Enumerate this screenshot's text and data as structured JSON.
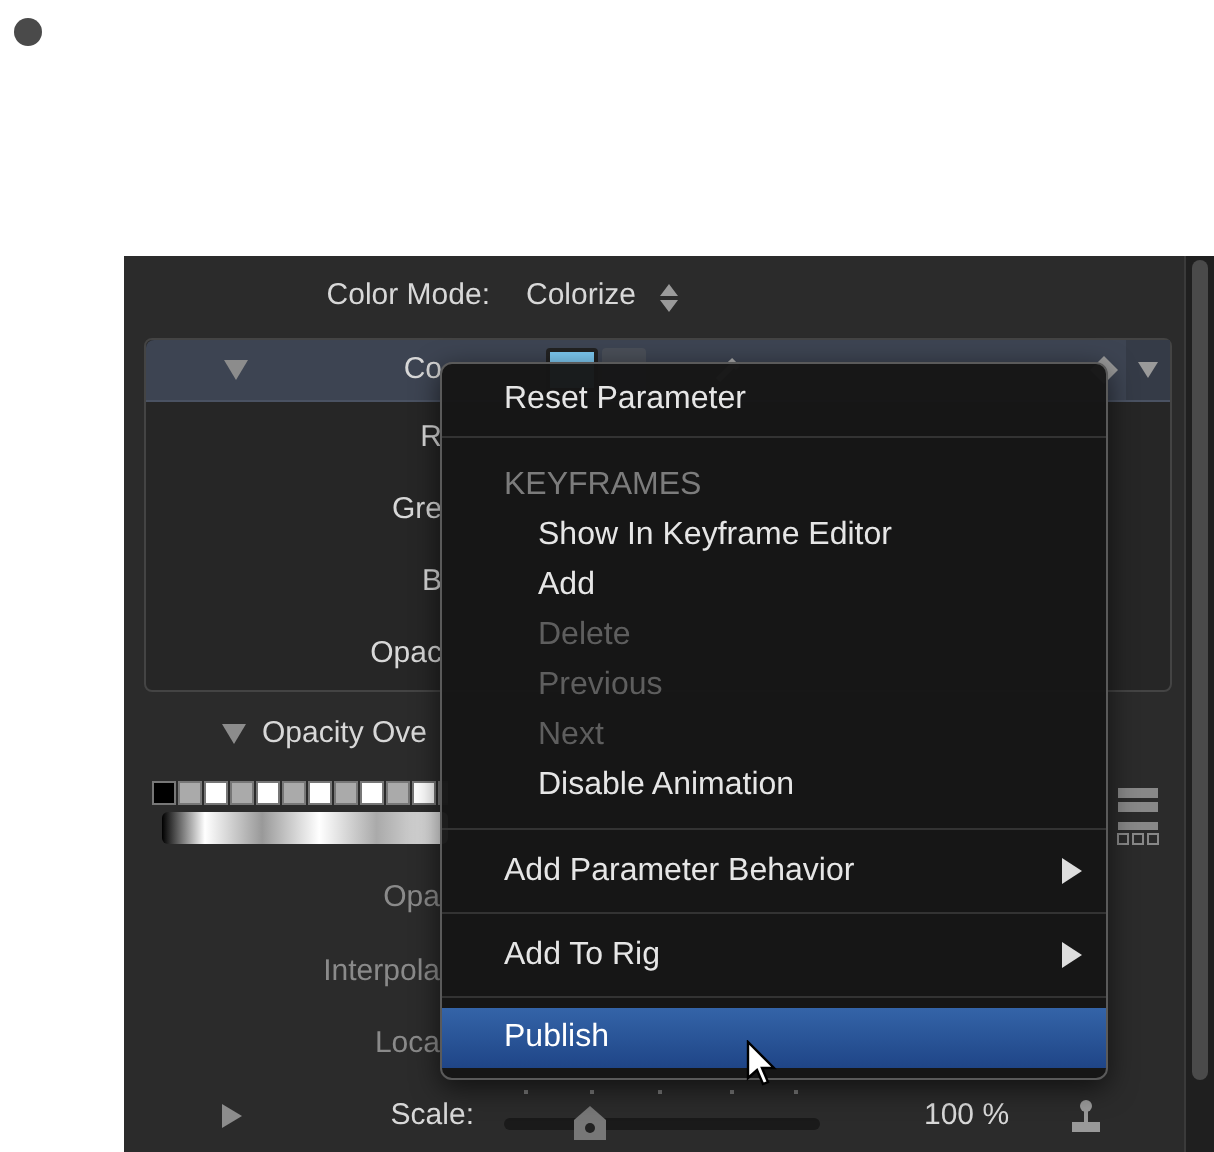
{
  "inspector": {
    "color_mode": {
      "label": "Color Mode:",
      "value": "Colorize"
    },
    "color_group": {
      "label": "Co",
      "expanded": true,
      "rows": [
        {
          "label": "R"
        },
        {
          "label": "Gre"
        },
        {
          "label": "B"
        },
        {
          "label": "Opac"
        }
      ]
    },
    "opacity_overlay": {
      "label": "Opacity Ove",
      "expanded": true,
      "rows": [
        {
          "label": "Opa"
        },
        {
          "label": "Interpola"
        },
        {
          "label": "Loca"
        }
      ]
    },
    "scale": {
      "label": "Scale:",
      "expanded": false,
      "level": 0.27,
      "value": "100 %"
    }
  },
  "context_menu": {
    "items": [
      {
        "kind": "item",
        "label": "Reset Parameter",
        "selected": false
      },
      {
        "kind": "separator"
      },
      {
        "kind": "header",
        "label": "KEYFRAMES"
      },
      {
        "kind": "subitem",
        "label": "Show In Keyframe Editor",
        "disabled": false,
        "selected": false
      },
      {
        "kind": "subitem",
        "label": "Add",
        "disabled": false,
        "selected": false
      },
      {
        "kind": "subitem",
        "label": "Delete",
        "disabled": true,
        "selected": false
      },
      {
        "kind": "subitem",
        "label": "Previous",
        "disabled": true,
        "selected": false
      },
      {
        "kind": "subitem",
        "label": "Next",
        "disabled": true,
        "selected": false
      },
      {
        "kind": "subitem",
        "label": "Disable Animation",
        "disabled": false,
        "selected": false
      },
      {
        "kind": "separator"
      },
      {
        "kind": "submenu",
        "label": "Add Parameter Behavior",
        "selected": false
      },
      {
        "kind": "separator"
      },
      {
        "kind": "submenu",
        "label": "Add To Rig",
        "selected": false
      },
      {
        "kind": "separator"
      },
      {
        "kind": "item",
        "label": "Publish",
        "selected": true
      }
    ]
  }
}
